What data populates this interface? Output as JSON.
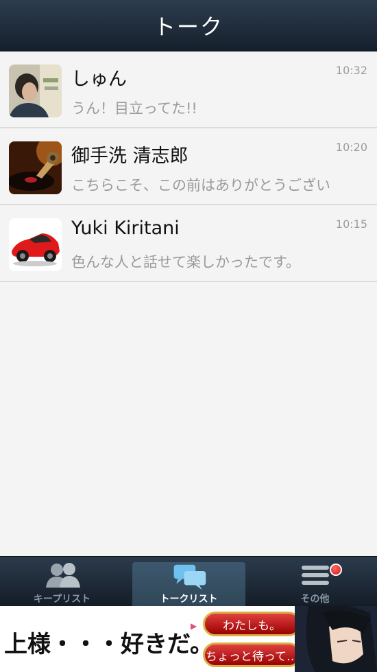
{
  "header": {
    "title": "トーク"
  },
  "chats": [
    {
      "name": "しゅん",
      "preview": "うん！目立ってた!!",
      "time": "10:32",
      "avatar": "person-photo"
    },
    {
      "name": "御手洗 清志郎",
      "preview": "こちらこそ、この前はありがとうございま",
      "time": "10:20",
      "avatar": "gramophone-photo"
    },
    {
      "name": "Yuki Kiritani",
      "preview": "色んな人と話せて楽しかったです。",
      "time": "10:15",
      "avatar": "red-car-photo"
    }
  ],
  "tabs": {
    "keep": {
      "label": "キープリスト",
      "icon": "people-icon"
    },
    "talk": {
      "label": "トークリスト",
      "icon": "chat-bubbles-icon"
    },
    "other": {
      "label": "その他",
      "icon": "menu-icon"
    }
  },
  "ad": {
    "headline": "上様・・・好きだ。",
    "option1": "わたしも。",
    "option2": "ちょっと待って…"
  },
  "colors": {
    "header": "#1f2b38",
    "badge": "#d51010",
    "ad_button": "#c82020"
  }
}
